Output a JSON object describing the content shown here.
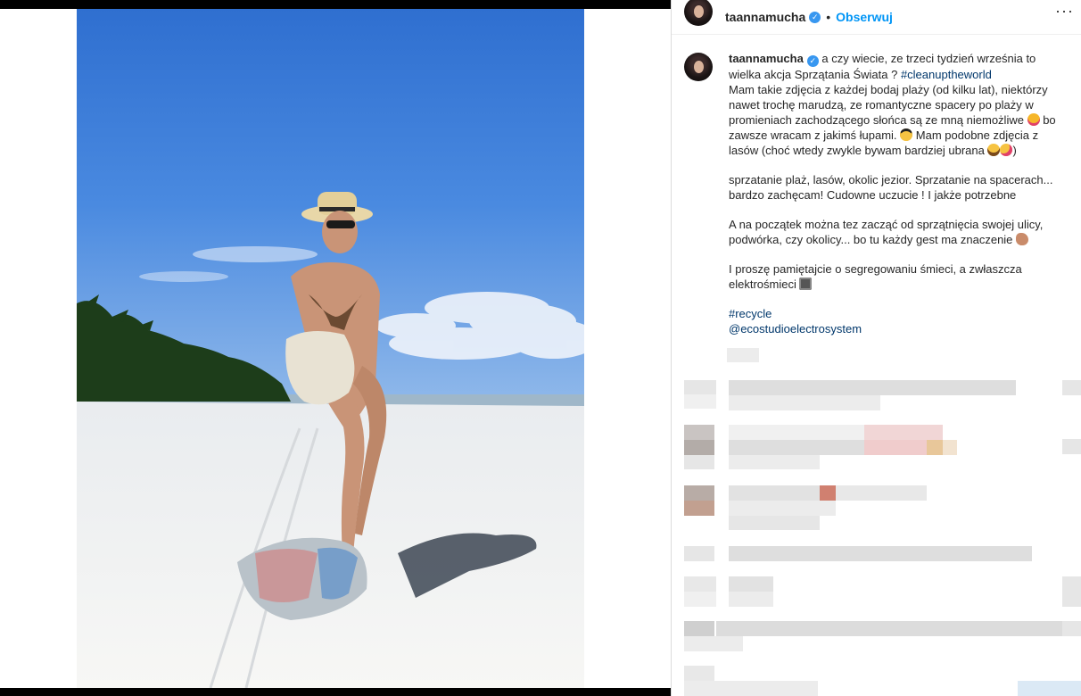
{
  "post": {
    "username": "taannamucha",
    "verified_mark": "✓",
    "separator": "•",
    "follow_label": "Obserwuj",
    "more_label": "···"
  },
  "caption": {
    "username": "taannamucha",
    "line1": " a czy wiecie, ze trzeci tydzień września to wielka akcja Sprzątania Świata ? ",
    "hashtag1": "#cleanuptheworld",
    "para1a": "Mam takie zdjęcia z każdej bodaj plaży (od kilku lat), niektórzy nawet trochę marudzą, ze romantyczne spacery po plaży w promieniach zachodzącego słońca są ze mną niemożliwe ",
    "para1b": " bo zawsze wracam z jakimś łupami. ",
    "para1c": " Mam podobne zdjęcia z lasów (choć wtedy zwykle bywam bardziej ubrana ",
    "para1d": ")",
    "para2": "sprzatanie plaż, lasów, okolic jezior. Sprzatanie na spacerach... bardzo zachęcam! Cudowne uczucie ! I jakże potrzebne",
    "para3": "A na początek można tez zacząć od sprzątnięcia swojej ulicy, podwórka, czy okolicy... bo tu każdy gest ma znaczenie ",
    "para4": "I proszę pamiętajcie o segregowaniu śmieci, a zwłaszcza elektrośmieci ",
    "hashtag2": "#recycle",
    "mention": "@ecostudioelectrosystem"
  },
  "icons": {
    "tongue": "face-with-tongue-icon",
    "cool": "sunglasses-face-icon",
    "laugh": "tears-of-joy-icon",
    "zany": "zany-face-icon",
    "muscle": "flexed-biceps-icon",
    "tv": "television-icon"
  },
  "colors": {
    "link_blue": "#0095f6",
    "hashtag_blue": "#00376b",
    "verified_blue": "#3897f0",
    "sky": "#3f7fd6",
    "sand": "#f2f2f0"
  }
}
